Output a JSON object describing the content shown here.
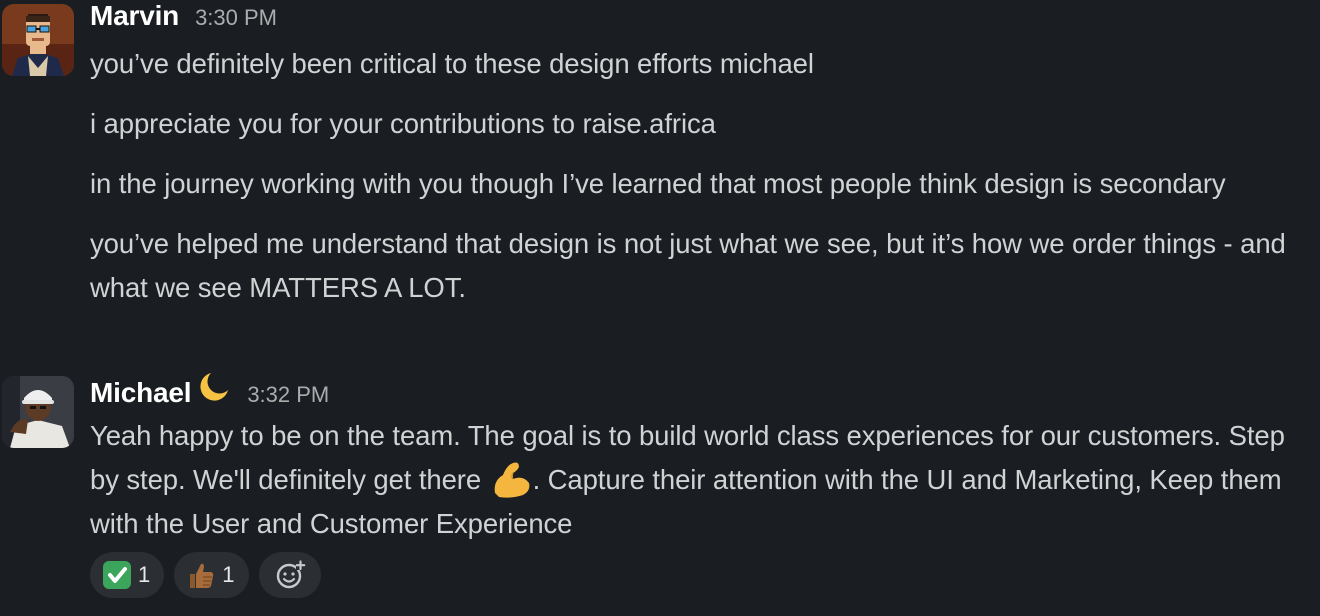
{
  "messages": [
    {
      "author": "Marvin",
      "time": "3:30 PM",
      "avatar_icon": "cartoon-avatar-icon",
      "paragraphs": [
        "you’ve definitely been critical to these design efforts michael",
        "i appreciate you for your contributions to raise.africa",
        "in the journey working with you though I’ve learned that most people think design is secondary",
        "you’ve helped me understand that design is not just what we see, but it’s how we order things - and what we see MATTERS A LOT."
      ]
    },
    {
      "author": "Michael",
      "status_emoji": "crescent-moon-icon",
      "time": "3:32 PM",
      "avatar_icon": "photo-avatar-icon",
      "body_part1": "Yeah happy to be on the team. The goal is to build world class experiences for our customers. Step by step. We'll definitely get there ",
      "inline_emoji": "flexed-biceps-icon",
      "body_part2": ". Capture their attention with the UI and Marketing, Keep them with the User and Customer Experience",
      "reactions": [
        {
          "emoji": "check-mark-button-icon",
          "count": "1"
        },
        {
          "emoji": "thumbs-up-icon",
          "count": "1"
        }
      ],
      "add_reaction_icon": "add-reaction-icon"
    }
  ],
  "colors": {
    "background": "#1a1d21",
    "text": "#d1d2d3",
    "author": "#ffffff",
    "timestamp": "#abacad",
    "reaction_pill": "#2b2e33"
  }
}
